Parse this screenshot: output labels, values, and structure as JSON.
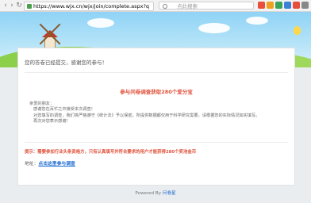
{
  "browser": {
    "url": "https://www.wjx.cn/wjx/join/complete.aspx?q",
    "search_placeholder": "点此搜索",
    "nav_icons": [
      "back-icon",
      "forward-icon",
      "reload-icon",
      "home-icon"
    ],
    "extension_icon_colors": [
      "#e94e3c",
      "#f0a020",
      "#3aa35a",
      "#3b82d6",
      "#e94e3c",
      "#888888"
    ]
  },
  "panel": {
    "notice": "您的答卷已经提交，感谢您的参与！",
    "activity_title": "参与问卷调查获取280个爱分宝",
    "description": [
      "亲爱的朋友：",
      "感谢您在百忙之中接受本次调查！",
      "对您填写的调查，我们将严格遵守《统计法》予以保密，所提供数据都仅用于科学研究需要。请根据您的实际情况如实填写。",
      "再次对您表示感谢！"
    ],
    "tip": "提示：需要参加行业头条资格方，只有认真填写并符合要求的用户才能获得280个奖池金币",
    "address_label": "地址：",
    "address_link": "点击这里参与调查"
  },
  "footer": {
    "powered_by": "Powered By",
    "brand": "问卷星"
  }
}
